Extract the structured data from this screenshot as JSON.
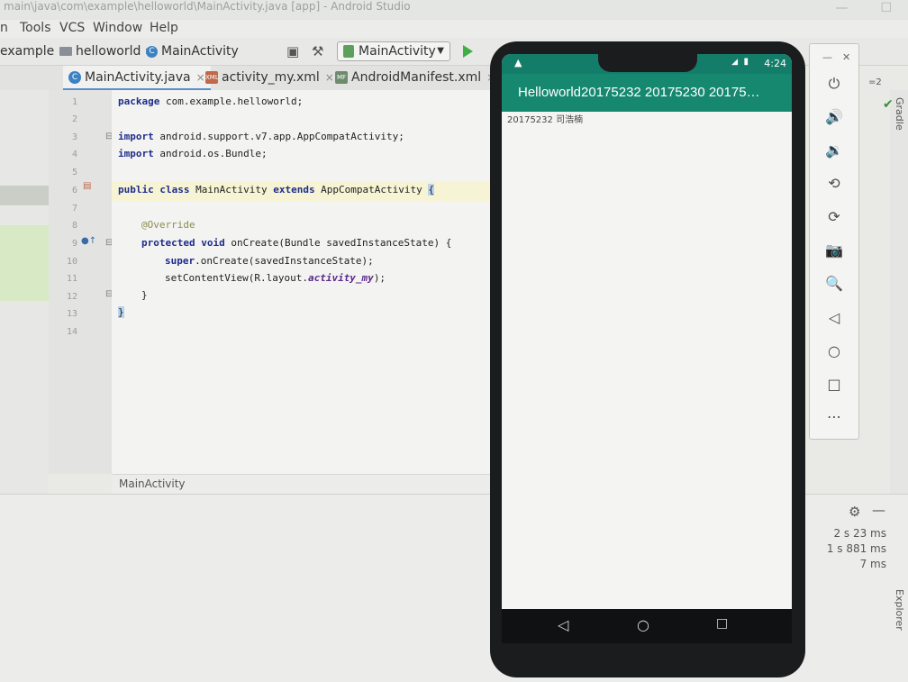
{
  "window": {
    "title": "main\\java\\com\\example\\helloworld\\MainActivity.java [app] - Android Studio"
  },
  "menu": [
    "n",
    "Tools",
    "VCS",
    "Window",
    "Help"
  ],
  "breadcrumb": [
    "example",
    "helloworld",
    "MainActivity"
  ],
  "run_config": "MainActivity",
  "tabs": [
    {
      "label": "MainActivity.java",
      "active": true
    },
    {
      "label": "activity_my.xml",
      "active": false
    },
    {
      "label": "AndroidManifest.xml",
      "active": false
    }
  ],
  "editor": {
    "line_numbers": [
      "1",
      "2",
      "3",
      "4",
      "5",
      "6",
      "7",
      "8",
      "9",
      "10",
      "11",
      "12",
      "13",
      "14"
    ],
    "lines": {
      "l1_kw": "package",
      "l1_rest": " com.example.helloworld;",
      "l3_kw": "import",
      "l3_rest": " android.support.v7.app.AppCompatActivity;",
      "l4_kw": "import",
      "l4_rest": " android.os.Bundle;",
      "l6_kw1": "public class",
      "l6_mid": " MainActivity ",
      "l6_kw2": "extends",
      "l6_rest": " AppCompatActivity ",
      "l6_brace": "{",
      "l8_ann": "@Override",
      "l9_kw": "protected void",
      "l9_rest": " onCreate(Bundle savedInstanceState) {",
      "l10_kw": "super",
      "l10_rest": ".onCreate(savedInstanceState);",
      "l11_a": "setContentView(R.layout.",
      "l11_it": "activity_my",
      "l11_b": ");",
      "l12": "}",
      "l13": "}"
    },
    "breadcrumb_footer": "MainActivity"
  },
  "bottom_panel": {
    "timings": [
      "2 s 23 ms",
      "1 s 881 ms",
      "7 ms"
    ]
  },
  "right_labels": {
    "gradle": "Gradle",
    "device_file_explorer": "Device File Explorer",
    "line_count_badge": "=2"
  },
  "phone": {
    "status_time": "4:24",
    "app_title": "Helloworld20175232 20175230 20175…",
    "content_text": "20175232 司浩楠"
  },
  "emulator_controls": [
    {
      "name": "power",
      "glyph": "⏻"
    },
    {
      "name": "volume-up",
      "glyph": "🔊"
    },
    {
      "name": "volume-down",
      "glyph": "🔉"
    },
    {
      "name": "rotate-left",
      "glyph": "⟲"
    },
    {
      "name": "rotate-right",
      "glyph": "⟳"
    },
    {
      "name": "screenshot",
      "glyph": "📷"
    },
    {
      "name": "zoom",
      "glyph": "🔍"
    },
    {
      "name": "back",
      "glyph": "◁"
    },
    {
      "name": "home",
      "glyph": "○"
    },
    {
      "name": "overview",
      "glyph": "□"
    },
    {
      "name": "more",
      "glyph": "⋯"
    }
  ],
  "colors": {
    "app_bar": "#15886f",
    "status_bar": "#137d6a",
    "keyword": "#1e2d8c",
    "line_highlight": "#f6f4d4"
  }
}
